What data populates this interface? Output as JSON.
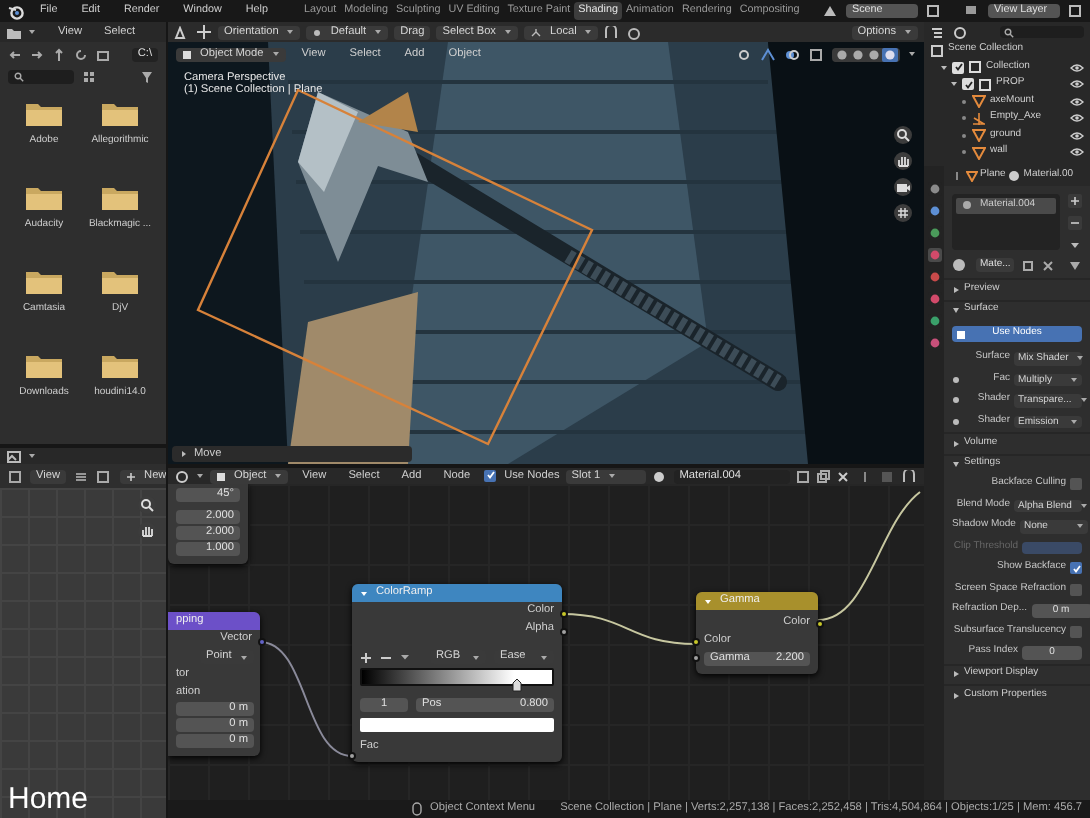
{
  "topbar": {
    "menus": [
      "File",
      "Edit",
      "Render",
      "Window",
      "Help"
    ],
    "workspaces": [
      {
        "label": "Layout",
        "selected": false
      },
      {
        "label": "Modeling",
        "selected": false
      },
      {
        "label": "Sculpting",
        "selected": false
      },
      {
        "label": "UV Editing",
        "selected": false
      },
      {
        "label": "Texture Paint",
        "selected": false
      },
      {
        "label": "Shading",
        "selected": true
      },
      {
        "label": "Animation",
        "selected": false
      },
      {
        "label": "Rendering",
        "selected": false
      },
      {
        "label": "Compositing",
        "selected": false
      }
    ],
    "scene": "Scene",
    "view_layer": "View Layer"
  },
  "file_browser": {
    "menus": [
      "View",
      "Select"
    ],
    "path": "C:\\",
    "folders": [
      "Adobe",
      "Allegorithmic",
      "Audacity",
      "Blackmagic ...",
      "Camtasia",
      "DjV",
      "Downloads",
      "houdini14.0"
    ]
  },
  "tool_header": {
    "orientation": "Orientation",
    "pivot": "Default",
    "drag": "Drag",
    "select": "Select Box",
    "transform": "Local",
    "options": "Options"
  },
  "viewport": {
    "mode": "Object Mode",
    "menus": [
      "View",
      "Select",
      "Add",
      "Object"
    ],
    "camera_label": "Camera Perspective",
    "collection_label": "(1) Scene Collection | Plane",
    "operator_panel": "Move",
    "shading_buttons": [
      {
        "selected": false
      },
      {
        "selected": false
      },
      {
        "selected": false
      },
      {
        "selected": true
      }
    ]
  },
  "image_editor": {
    "menu": "View",
    "new_button": "New"
  },
  "node_editor": {
    "object": "Object",
    "menus": [
      "View",
      "Select",
      "Add",
      "Node"
    ],
    "use_nodes": {
      "label": "Use Nodes",
      "checked": true
    },
    "slot": "Slot 1",
    "material": "Material.004",
    "nodes": [
      {
        "kind": "values",
        "fields": [
          "45°",
          "2.000",
          "2.000",
          "1.000"
        ]
      },
      {
        "kind": "mapping",
        "title": "pping",
        "output": "Vector",
        "dropdown": "Point",
        "labels": [
          "tor",
          "ation"
        ],
        "fields": [
          "0 m",
          "0 m",
          "0 m"
        ]
      },
      {
        "kind": "colorramp",
        "title": "ColorRamp",
        "outputs": [
          "Color",
          "Alpha"
        ],
        "color_mode": "RGB",
        "interpolation": "Ease",
        "stop_index": "1",
        "pos_label": "Pos",
        "pos_value": "0.800",
        "input": "Fac"
      },
      {
        "kind": "gamma",
        "title": "Gamma",
        "output": "Color",
        "input": "Color",
        "field_label": "Gamma",
        "field_value": "2.200"
      }
    ]
  },
  "status_bar": {
    "hint": "Object Context Menu",
    "stats": "Scene Collection | Plane | Verts:2,257,138 | Faces:2,252,458 | Tris:4,504,864 | Objects:1/25 | Mem: 456.7"
  },
  "outliner": {
    "root": "Scene Collection",
    "items": [
      {
        "label": "Collection",
        "kind": "collection",
        "included": true,
        "children": [
          {
            "label": "PROP",
            "kind": "collection",
            "included": true,
            "children": [
              {
                "label": "axeMount",
                "kind": "mesh"
              },
              {
                "label": "Empty_Axe",
                "kind": "empty"
              },
              {
                "label": "ground",
                "kind": "mesh"
              },
              {
                "label": "wall",
                "kind": "mesh"
              }
            ]
          }
        ]
      }
    ]
  },
  "properties": {
    "object": "Plane",
    "material_tab": "Material.00",
    "slots": [
      "Material.004"
    ],
    "browse": "Mate...",
    "rows": [
      {
        "kind": "panel",
        "label": "Preview",
        "expanded": false
      },
      {
        "kind": "panel",
        "label": "Surface",
        "expanded": true
      },
      {
        "kind": "button",
        "label": "Use Nodes",
        "on": true
      },
      {
        "kind": "prop",
        "label": "Surface",
        "value": "Mix Shader",
        "socket": false
      },
      {
        "kind": "prop",
        "label": "Fac",
        "value": "Multiply",
        "socket": true
      },
      {
        "kind": "prop",
        "label": "Shader",
        "value": "Transpare...",
        "socket": true
      },
      {
        "kind": "prop",
        "label": "Shader",
        "value": "Emission",
        "socket": true
      },
      {
        "kind": "panel",
        "label": "Volume",
        "expanded": false
      },
      {
        "kind": "panel",
        "label": "Settings",
        "expanded": true
      },
      {
        "kind": "check",
        "label": "Backface Culling",
        "checked": false
      },
      {
        "kind": "prop",
        "label": "Blend Mode",
        "value": "Alpha Blend",
        "socket": false
      },
      {
        "kind": "prop",
        "label": "Shadow Mode",
        "value": "None",
        "socket": false
      },
      {
        "kind": "field",
        "label": "Clip Threshold",
        "value": "",
        "disabled": true
      },
      {
        "kind": "check",
        "label": "Show Backface",
        "checked": true
      },
      {
        "kind": "check",
        "label": "Screen Space Refraction",
        "checked": false
      },
      {
        "kind": "field",
        "label": "Refraction Dep...",
        "value": "0 m",
        "disabled": false
      },
      {
        "kind": "check",
        "label": "Subsurface Translucency",
        "checked": false
      },
      {
        "kind": "field",
        "label": "Pass Index",
        "value": "0",
        "disabled": false
      },
      {
        "kind": "panel",
        "label": "Viewport Display",
        "expanded": false
      },
      {
        "kind": "panel",
        "label": "Custom Properties",
        "expanded": false
      }
    ]
  },
  "caption": "Home"
}
